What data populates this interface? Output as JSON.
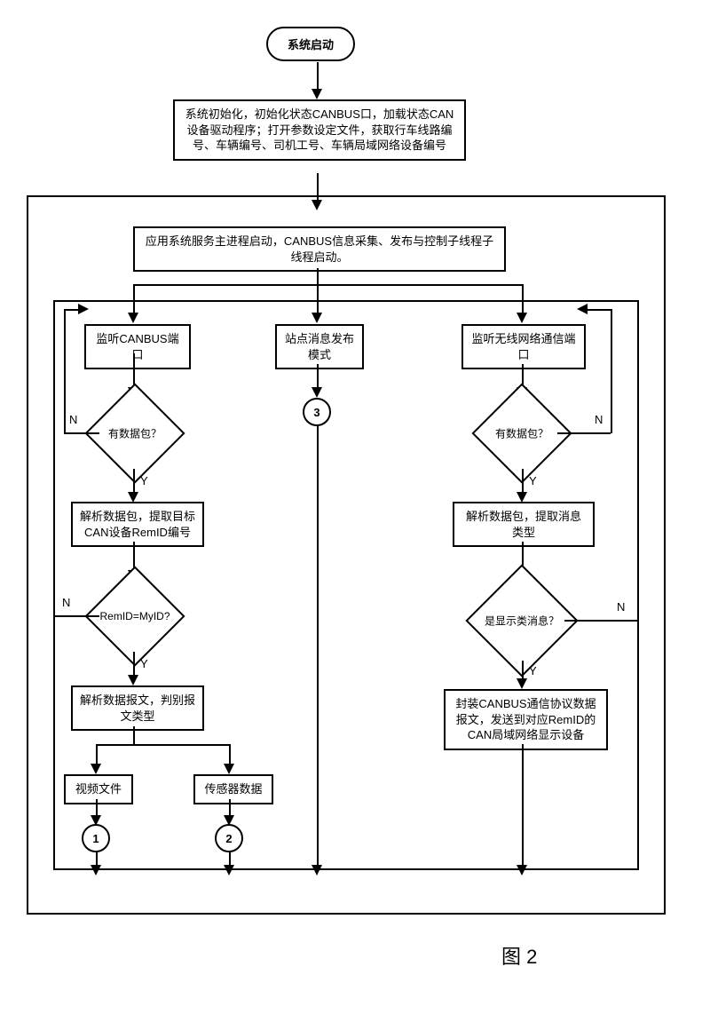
{
  "start": "系统启动",
  "init": "系统初始化，初始化状态CANBUS口，加载状态CAN设备驱动程序；打开参数设定文件，获取行车线路编号、车辆编号、司机工号、车辆局域网络设备编号",
  "mainProc": "应用系统服务主进程启动，CANBUS信息采集、发布与控制子线程子线程启动。",
  "left": {
    "listen": "监听CANBUS端口",
    "hasData": "有数据包？",
    "parse1": "解析数据包，提取目标CAN设备RemID编号",
    "check": "RemID=MyID?",
    "parse2": "解析数据报文，判别报文类型",
    "video": "视频文件",
    "sensor": "传感器数据"
  },
  "mid": {
    "mode": "站点消息发布模式"
  },
  "right": {
    "listen": "监听无线网络通信端口",
    "hasData": "有数据包？",
    "isDisplay": "是显示类消息？",
    "parse": "解析数据包，提取消息类型",
    "encap": "封装CANBUS通信协议数据报文，发送到对应RemID的CAN局域网络显示设备"
  },
  "yn": {
    "y": "Y",
    "n": "N"
  },
  "conn": {
    "c1": "1",
    "c2": "2",
    "c3": "3"
  },
  "caption": "图  2"
}
